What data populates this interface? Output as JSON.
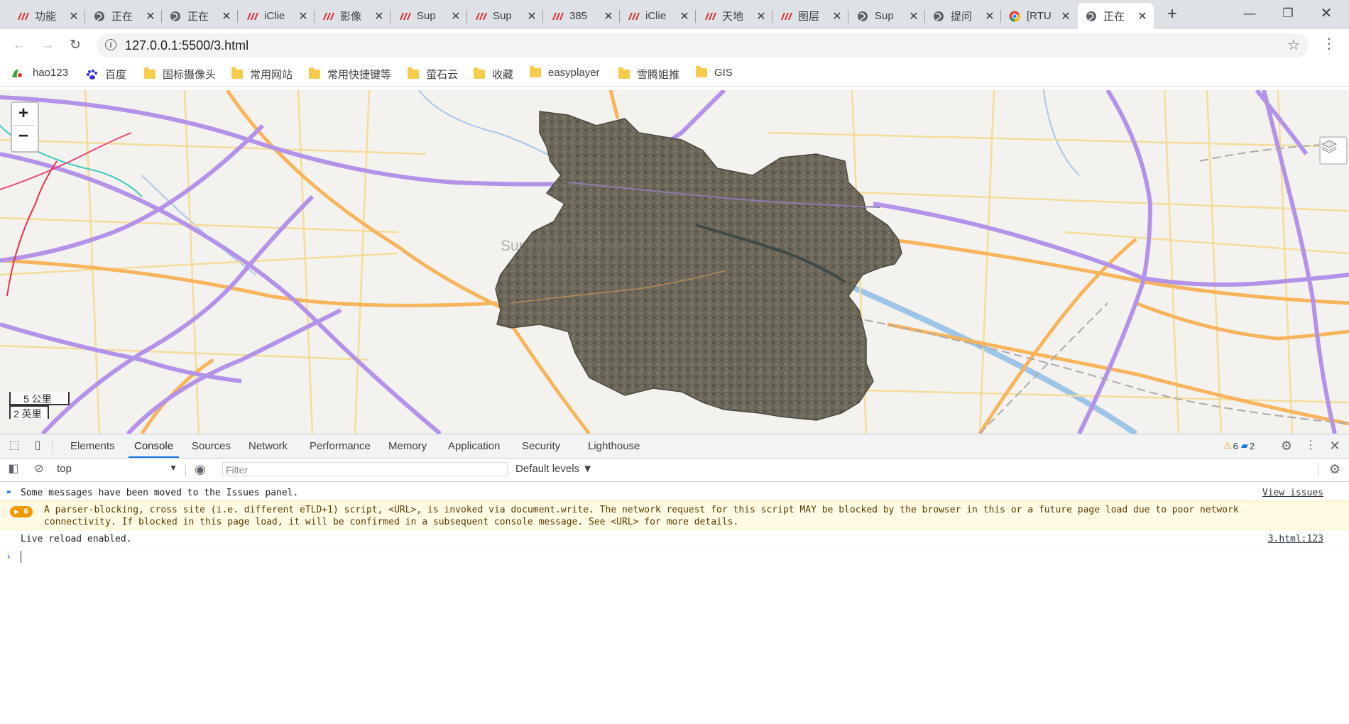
{
  "tabs": [
    {
      "title": "功能",
      "icon": "supermap-logo-icon"
    },
    {
      "title": "正在",
      "icon": "globe-icon"
    },
    {
      "title": "正在",
      "icon": "globe-icon"
    },
    {
      "title": "iClie",
      "icon": "supermap-logo-icon"
    },
    {
      "title": "影像",
      "icon": "supermap-logo-icon"
    },
    {
      "title": "Sup",
      "icon": "supermap-logo-icon"
    },
    {
      "title": "Sup",
      "icon": "supermap-logo-icon"
    },
    {
      "title": "385",
      "icon": "supermap-logo-icon"
    },
    {
      "title": "iClie",
      "icon": "supermap-logo-icon"
    },
    {
      "title": "天地",
      "icon": "supermap-logo-icon"
    },
    {
      "title": "图层",
      "icon": "supermap-logo-icon"
    },
    {
      "title": "Sup",
      "icon": "globe-icon"
    },
    {
      "title": "提问",
      "icon": "globe-icon"
    },
    {
      "title": "[RTU",
      "icon": "chrome-icon"
    },
    {
      "title": "正在",
      "icon": "globe-icon",
      "active": true
    }
  ],
  "address": {
    "url": "127.0.0.1:5500/3.html"
  },
  "bookmarks": [
    "hao123",
    "百度",
    "国标摄像头",
    "常用网站",
    "常用快捷键等",
    "萤石云",
    "收藏",
    "easyplayer",
    "雪腾姐推",
    "GIS"
  ],
  "map": {
    "zoom_in": "+",
    "zoom_out": "−",
    "scale_metric": "5 公里",
    "scale_imperial": "2 英里",
    "watermark": "SuperMap Trial site"
  },
  "devtools": {
    "tabs": [
      "Elements",
      "Console",
      "Sources",
      "Network",
      "Performance",
      "Memory",
      "Application",
      "Security",
      "Lighthouse"
    ],
    "active_tab": "Console",
    "warnings_count": "6",
    "issues_count": "2",
    "context": "top",
    "filter_placeholder": "Filter",
    "levels": "Default levels ▼",
    "messages": {
      "issues_moved": "Some messages have been moved to the Issues panel.",
      "view_issues": "View issues",
      "warn_count": "▶ 6",
      "warn_line1": "A parser-blocking, cross site (i.e. different eTLD+1) script, <URL>, is invoked via document.write. The network request for this script MAY be blocked by the browser in this or a future page load due to poor network",
      "warn_line2": "connectivity. If blocked in this page load, it will be confirmed in a subsequent console message. See <URL> for more details.",
      "live_reload": "Live reload enabled.",
      "live_reload_src": "3.html:123"
    }
  }
}
